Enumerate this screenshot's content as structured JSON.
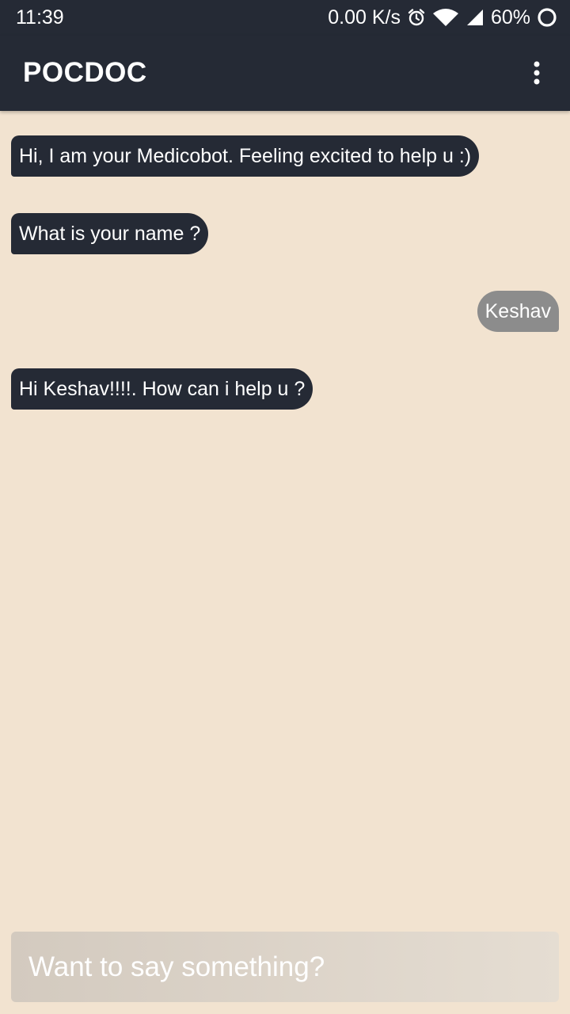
{
  "status_bar": {
    "time": "11:39",
    "net_speed": "0.00 K/s",
    "battery": "60%",
    "icons": [
      "alarm-icon",
      "wifi-icon",
      "signal-icon",
      "battery-ring-icon"
    ]
  },
  "app_bar": {
    "title": "POCDOC",
    "menu_icon": "more-vert-icon"
  },
  "messages": [
    {
      "sender": "bot",
      "text": "Hi, I am your Medicobot. Feeling excited to help u :)"
    },
    {
      "sender": "bot",
      "text": "What is your name ?"
    },
    {
      "sender": "user",
      "text": "Keshav"
    },
    {
      "sender": "bot",
      "text": "Hi Keshav!!!!. How can i help u ?"
    }
  ],
  "composer": {
    "placeholder": "Want to say something?",
    "value": ""
  },
  "colors": {
    "app_bar": "#252a35",
    "background": "#f2e3d0",
    "bot_bubble": "#252a35",
    "user_bubble": "#8c8c8c"
  }
}
